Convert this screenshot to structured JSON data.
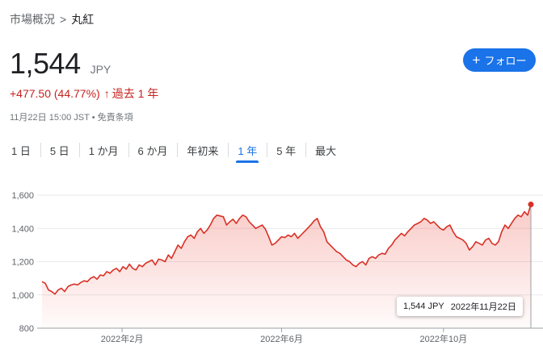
{
  "breadcrumb": {
    "parent": "市場概況",
    "separator": ">",
    "current": "丸紅"
  },
  "quote": {
    "price": "1,544",
    "currency": "JPY",
    "change": "+477.50 (44.77%)",
    "change_arrow": "↑",
    "period": "過去 1 年"
  },
  "meta": {
    "timestamp": "11月22日 15:00 JST",
    "bullet": "•",
    "disclaimer": "免責条項"
  },
  "follow_button": {
    "icon": "plus-icon",
    "label": "フォロー"
  },
  "tabs": [
    {
      "label": "1 日"
    },
    {
      "label": "5 日"
    },
    {
      "label": "1 か月"
    },
    {
      "label": "6 か月"
    },
    {
      "label": "年初来"
    },
    {
      "label": "1 年",
      "active": true
    },
    {
      "label": "5 年"
    },
    {
      "label": "最大"
    }
  ],
  "tooltip": {
    "value": "1,544 JPY",
    "date": "2022年11月22日"
  },
  "colors": {
    "accent": "#1a73e8",
    "line": "#d93025",
    "negative_text": "#c5221f"
  },
  "chart_data": {
    "type": "area",
    "title": "",
    "xlabel": "",
    "ylabel": "",
    "ylim": [
      800,
      1600
    ],
    "yticks": [
      800,
      1000,
      1200,
      1400,
      1600
    ],
    "ytick_labels": [
      "800",
      "1,000",
      "1,200",
      "1,400",
      "1,600"
    ],
    "grid": true,
    "xticks": [
      {
        "label": "2022年2月",
        "x": 0.172
      },
      {
        "label": "2022年6月",
        "x": 0.495
      },
      {
        "label": "2022年10月",
        "x": 0.823
      }
    ],
    "series": [
      {
        "values": [
          1080,
          1070,
          1030,
          1020,
          1005,
          1030,
          1040,
          1020,
          1050,
          1060,
          1065,
          1060,
          1075,
          1085,
          1080,
          1100,
          1110,
          1095,
          1120,
          1115,
          1140,
          1130,
          1150,
          1160,
          1140,
          1170,
          1155,
          1185,
          1160,
          1150,
          1180,
          1170,
          1190,
          1200,
          1210,
          1180,
          1215,
          1210,
          1200,
          1240,
          1220,
          1260,
          1300,
          1280,
          1320,
          1350,
          1360,
          1340,
          1380,
          1400,
          1370,
          1390,
          1420,
          1460,
          1480,
          1475,
          1470,
          1420,
          1440,
          1455,
          1430,
          1460,
          1480,
          1470,
          1440,
          1420,
          1400,
          1410,
          1420,
          1395,
          1350,
          1300,
          1310,
          1330,
          1350,
          1345,
          1360,
          1350,
          1370,
          1340,
          1360,
          1380,
          1400,
          1420,
          1445,
          1460,
          1410,
          1380,
          1320,
          1300,
          1280,
          1260,
          1250,
          1230,
          1210,
          1200,
          1180,
          1170,
          1190,
          1200,
          1180,
          1220,
          1230,
          1220,
          1240,
          1250,
          1245,
          1280,
          1300,
          1330,
          1350,
          1370,
          1355,
          1380,
          1400,
          1420,
          1430,
          1440,
          1460,
          1450,
          1430,
          1440,
          1420,
          1400,
          1390,
          1410,
          1420,
          1380,
          1350,
          1340,
          1330,
          1310,
          1270,
          1290,
          1320,
          1310,
          1300,
          1330,
          1340,
          1310,
          1300,
          1320,
          1380,
          1420,
          1400,
          1430,
          1460,
          1480,
          1470,
          1500,
          1480,
          1544
        ]
      }
    ],
    "last_value": 1544
  }
}
